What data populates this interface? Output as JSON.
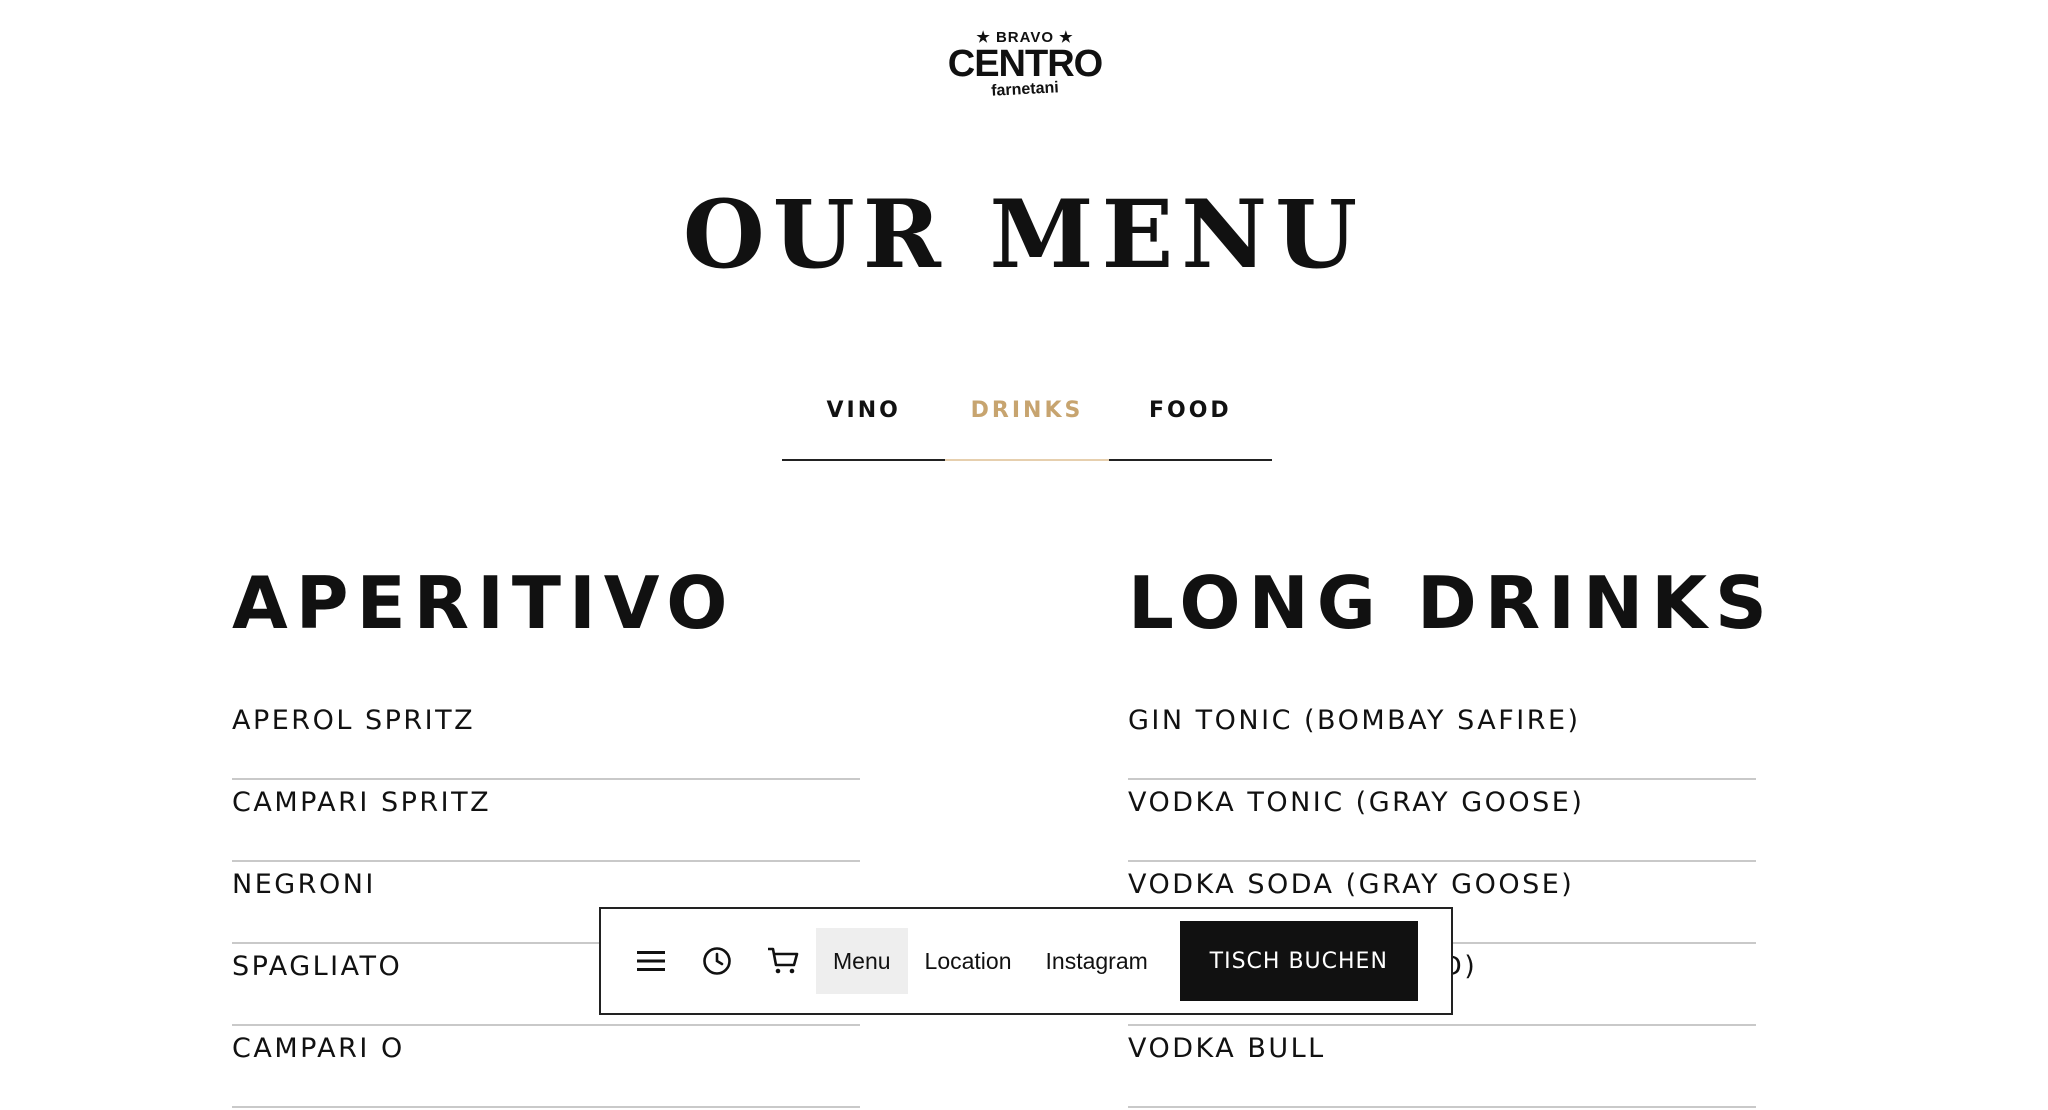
{
  "brand": {
    "top": "★ BRAVO ★",
    "main": "CENTRO",
    "bottom": "farnetani"
  },
  "page_title": "OUR MENU",
  "tabs": [
    {
      "label": "VINO",
      "active": false
    },
    {
      "label": "DRINKS",
      "active": true
    },
    {
      "label": "FOOD",
      "active": false
    }
  ],
  "accent_color": "#c7a46f",
  "sections": {
    "aperitivo": {
      "title": "APERITIVO",
      "items": [
        "APEROL SPRITZ",
        "CAMPARI SPRITZ",
        "NEGRONI",
        "SPAGLIATO",
        "CAMPARI O"
      ]
    },
    "long_drinks": {
      "title": "LONG DRINKS",
      "items": [
        "GIN TONIC (BOMBAY SAFIRE)",
        "VODKA TONIC (GRAY GOOSE)",
        "VODKA SODA (GRAY GOOSE)",
        "D)",
        "VODKA BULL"
      ]
    }
  },
  "navbar": {
    "icons": [
      "menu-icon",
      "clock-icon",
      "cart-icon"
    ],
    "links": [
      {
        "label": "Menu",
        "active": true
      },
      {
        "label": "Location",
        "active": false
      },
      {
        "label": "Instagram",
        "active": false
      }
    ],
    "cta": "TISCH BUCHEN"
  }
}
